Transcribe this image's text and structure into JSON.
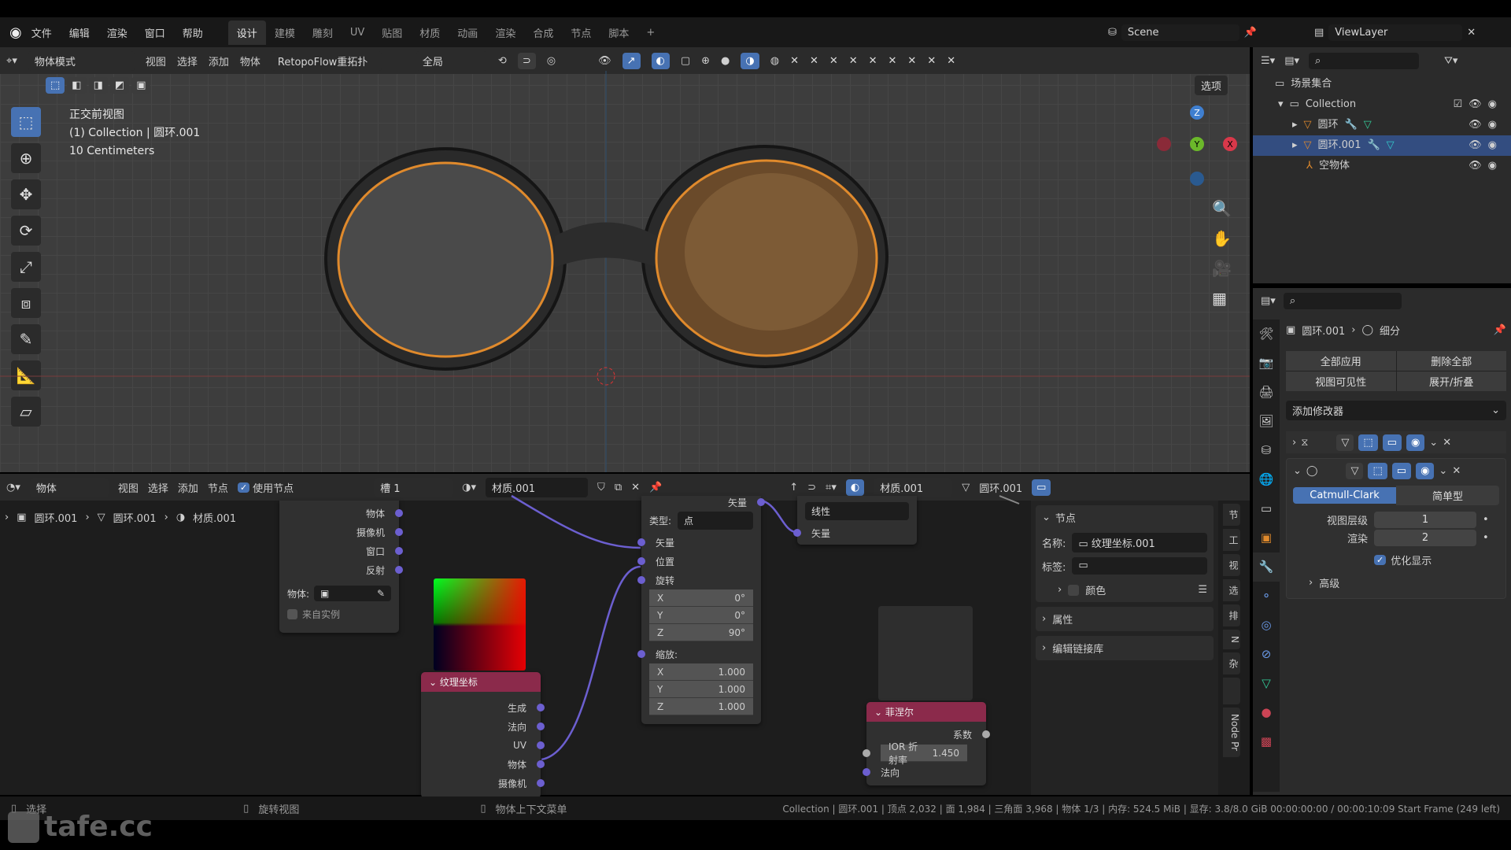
{
  "menu": {
    "items": [
      "文件",
      "编辑",
      "渲染",
      "窗口",
      "帮助"
    ],
    "workspaces": [
      "设计",
      "建模",
      "雕刻",
      "UV",
      "贴图",
      "材质",
      "动画",
      "渲染",
      "合成",
      "节点",
      "脚本"
    ],
    "active_workspace": "设计",
    "add_tab": "+"
  },
  "scene": {
    "name": "Scene",
    "view_layer": "ViewLayer"
  },
  "viewport": {
    "header": {
      "mode": "物体模式",
      "menus": [
        "视图",
        "选择",
        "添加",
        "物体"
      ],
      "addon": "RetopoFlow重拓扑",
      "orientation": "全局",
      "options": "选项"
    },
    "overlay": {
      "view_name": "正交前视图",
      "collection": "(1) Collection | 圆环.001",
      "scale": "10 Centimeters"
    },
    "gizmo": {
      "x": "X",
      "y": "Y",
      "z": "Z"
    }
  },
  "outliner": {
    "root": "场景集合",
    "items": [
      {
        "name": "Collection",
        "type": "collection"
      },
      {
        "name": "圆环",
        "type": "mesh"
      },
      {
        "name": "圆环.001",
        "type": "mesh",
        "selected": true
      },
      {
        "name": "空物体",
        "type": "empty"
      }
    ]
  },
  "properties": {
    "breadcrumb": {
      "object": "圆环.001",
      "modifier": "细分"
    },
    "apply_all": "全部应用",
    "delete_all": "删除全部",
    "viewport_vis": "视图可见性",
    "expand_collapse": "展开/折叠",
    "add_modifier": "添加修改器",
    "subdiv": {
      "catmull": "Catmull-Clark",
      "simple": "简单型",
      "levels_label": "视图层级",
      "levels": "1",
      "render_label": "渲染",
      "render": "2",
      "optimal": "优化显示",
      "optimal_checked": true,
      "advanced": "高级"
    }
  },
  "node_editor": {
    "header": {
      "type": "物体",
      "menus": [
        "视图",
        "选择",
        "添加",
        "节点"
      ],
      "use_nodes": "使用节点",
      "use_nodes_checked": true,
      "slot": "槽 1",
      "material": "材质.001",
      "mesh": "圆环.001"
    },
    "breadcrumb": [
      "圆环.001",
      "圆环.001",
      "材质.001"
    ],
    "texcoord_top": {
      "outputs": [
        "物体",
        "摄像机",
        "窗口",
        "反射"
      ],
      "object_label": "物体:",
      "from_instancer": "来自实例"
    },
    "texcoord": {
      "title": "纹理坐标",
      "outputs": [
        "生成",
        "法向",
        "UV",
        "物体",
        "摄像机"
      ]
    },
    "mapping": {
      "out": "矢量",
      "type_label": "类型:",
      "type": "点",
      "inputs": [
        "矢量",
        "位置",
        "旋转"
      ],
      "rotation": [
        [
          "X",
          "0°"
        ],
        [
          "Y",
          "0°"
        ],
        [
          "Z",
          "90°"
        ]
      ],
      "scale_label": "缩放:",
      "scale": [
        [
          "X",
          "1.000"
        ],
        [
          "Y",
          "1.000"
        ],
        [
          "Z",
          "1.000"
        ]
      ]
    },
    "ramp": {
      "interp": "线性",
      "in": "矢量"
    },
    "fresnel": {
      "title": "菲涅尔",
      "out": "系数",
      "ior": "IOR 折射率",
      "ior_value": "1.450",
      "normal": "法向"
    },
    "sidebar": {
      "node_section": "节点",
      "name_label": "名称:",
      "name": "纹理坐标.001",
      "label_label": "标签:",
      "color": "颜色",
      "attributes": "属性",
      "library": "编辑链接库",
      "tabs": [
        "节",
        "工",
        "视",
        "选",
        "排",
        "N",
        "杂",
        "",
        "Node Pr"
      ]
    }
  },
  "status": {
    "select": "选择",
    "rotate": "旋转视图",
    "context": "物体上下文菜单",
    "info": "Collection | 圆环.001 | 顶点 2,032 | 面 1,984 | 三角面 3,968 | 物体 1/3 | 内存: 524.5 MiB | 显存: 3.8/8.0 GiB   00:00:00:00 / 00:00:10:09  Start Frame (249 left)"
  },
  "watermark": "tafe.cc",
  "colors": {
    "accent": "#4772b3",
    "node_header": "#8b2a4b",
    "socket": "#6c5fd0",
    "frame": "#e08a2c"
  }
}
